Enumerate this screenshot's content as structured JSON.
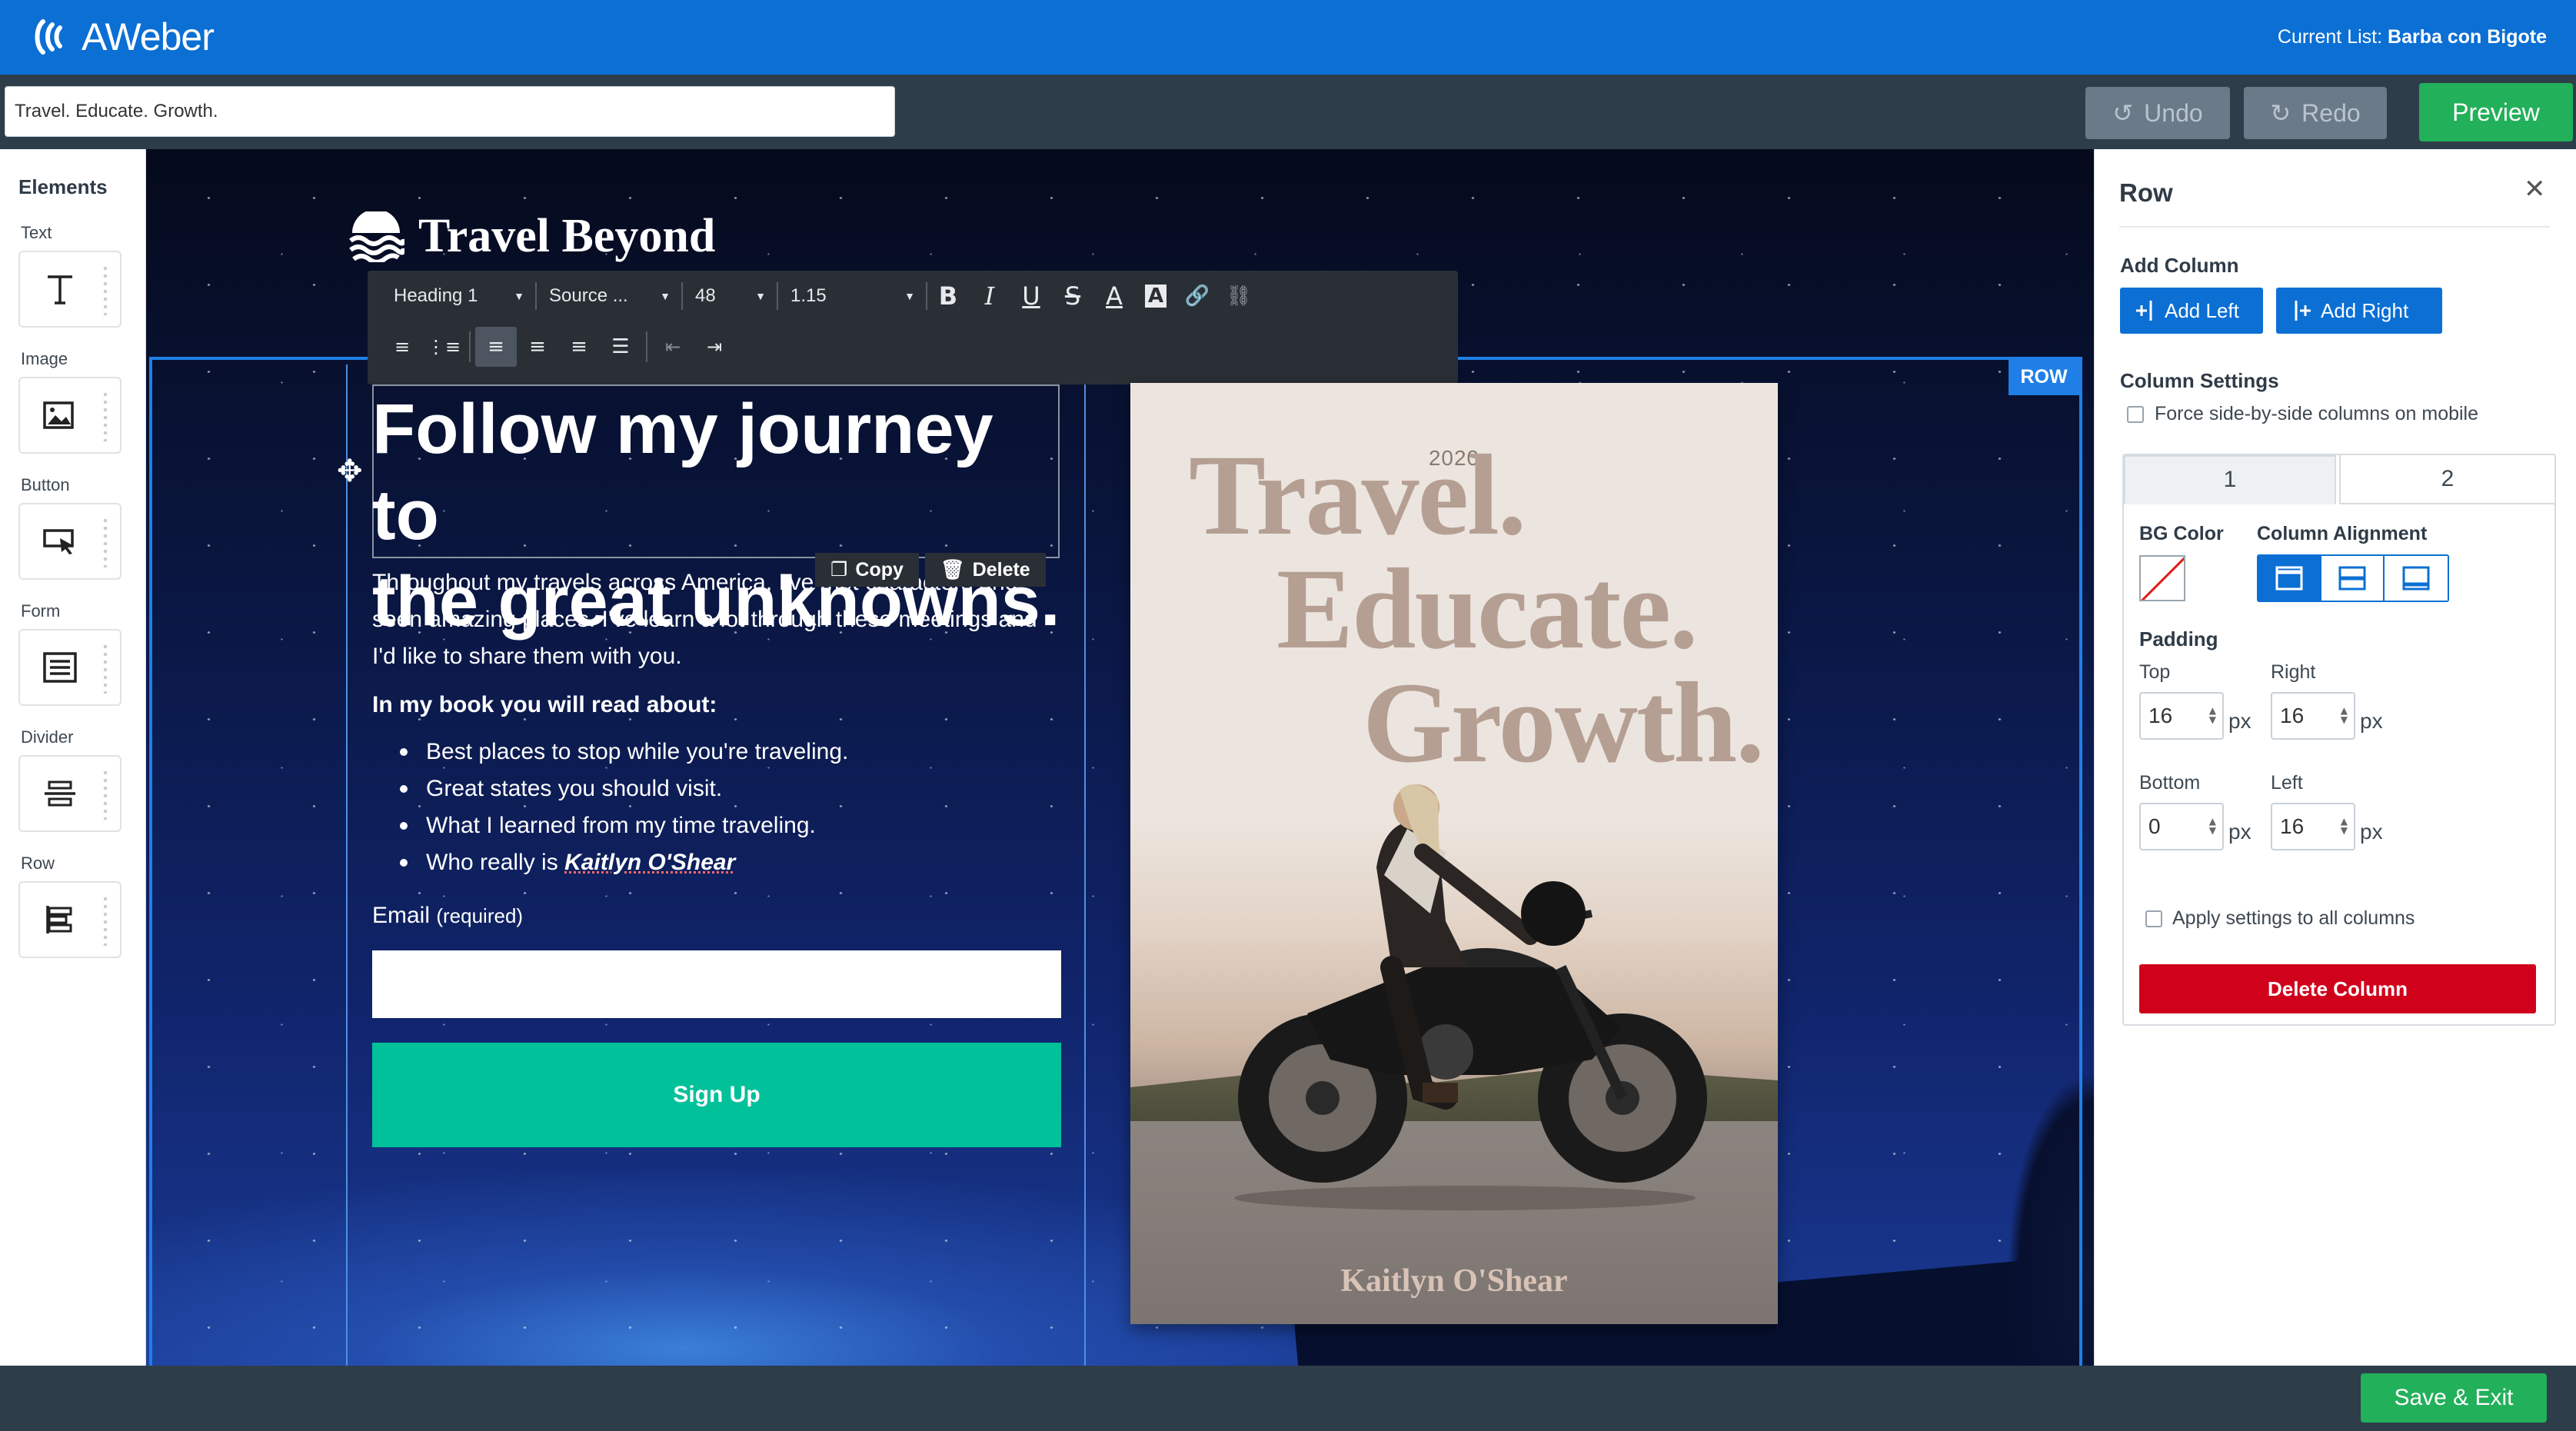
{
  "header": {
    "logo_text": "AWeber",
    "current_list_label": "Current List:",
    "current_list_value": "Barba con Bigote"
  },
  "toolbar": {
    "message_name": "Travel. Educate. Growth.",
    "undo_label": "Undo",
    "redo_label": "Redo",
    "preview_label": "Preview"
  },
  "palette": {
    "title": "Elements",
    "items": [
      {
        "label": "Text",
        "icon": "text-icon"
      },
      {
        "label": "Image",
        "icon": "image-icon"
      },
      {
        "label": "Button",
        "icon": "button-icon"
      },
      {
        "label": "Form",
        "icon": "form-icon"
      },
      {
        "label": "Divider",
        "icon": "divider-icon"
      },
      {
        "label": "Row",
        "icon": "row-icon"
      }
    ]
  },
  "canvas": {
    "brand": "Travel Beyond",
    "row_badge": "ROW",
    "text_toolbar": {
      "style": "Heading 1",
      "font": "Source ...",
      "size": "48",
      "line_height": "1.15"
    },
    "heading_line1": "Follow my journey to",
    "heading_line2": "the great unknowns.",
    "copy_label": "Copy",
    "delete_label": "Delete",
    "body": "Throughout my travels across America, I've met characters and seen amazing places. I've learn a lot through these meetings and I'd like to share them with you.",
    "book_heading": "In my book you will read about:",
    "bullets": [
      "Best places to stop while you're traveling.",
      "Great states you should visit.",
      "What I learned from my time traveling."
    ],
    "bullet_last_prefix": "Who really is",
    "bullet_last_name": "Kaitlyn O'Shear",
    "email_label": "Email",
    "email_required": "(required)",
    "signup_label": "Sign Up",
    "book": {
      "year": "2020",
      "line1": "Travel.",
      "line2": "Educate.",
      "line3": "Growth.",
      "author": "Kaitlyn O'Shear"
    }
  },
  "panel": {
    "title": "Row",
    "add_column_label": "Add Column",
    "add_left": "Add Left",
    "add_right": "Add Right",
    "column_settings_label": "Column Settings",
    "force_mobile_label": "Force side-by-side columns on mobile",
    "tabs": [
      "1",
      "2"
    ],
    "bg_color_label": "BG Color",
    "column_alignment_label": "Column Alignment",
    "padding_label": "Padding",
    "top_label": "Top",
    "right_label": "Right",
    "bottom_label": "Bottom",
    "left_label": "Left",
    "padding": {
      "top": "16",
      "right": "16",
      "bottom": "0",
      "left": "16"
    },
    "unit": "px",
    "apply_all_label": "Apply settings to all columns",
    "delete_column_label": "Delete Column"
  },
  "footer": {
    "save_exit_label": "Save & Exit"
  },
  "colors": {
    "brand_blue": "#0b6fd4",
    "preview_green": "#22b05a",
    "signup_teal": "#00c19a",
    "delete_red": "#d0021b"
  }
}
